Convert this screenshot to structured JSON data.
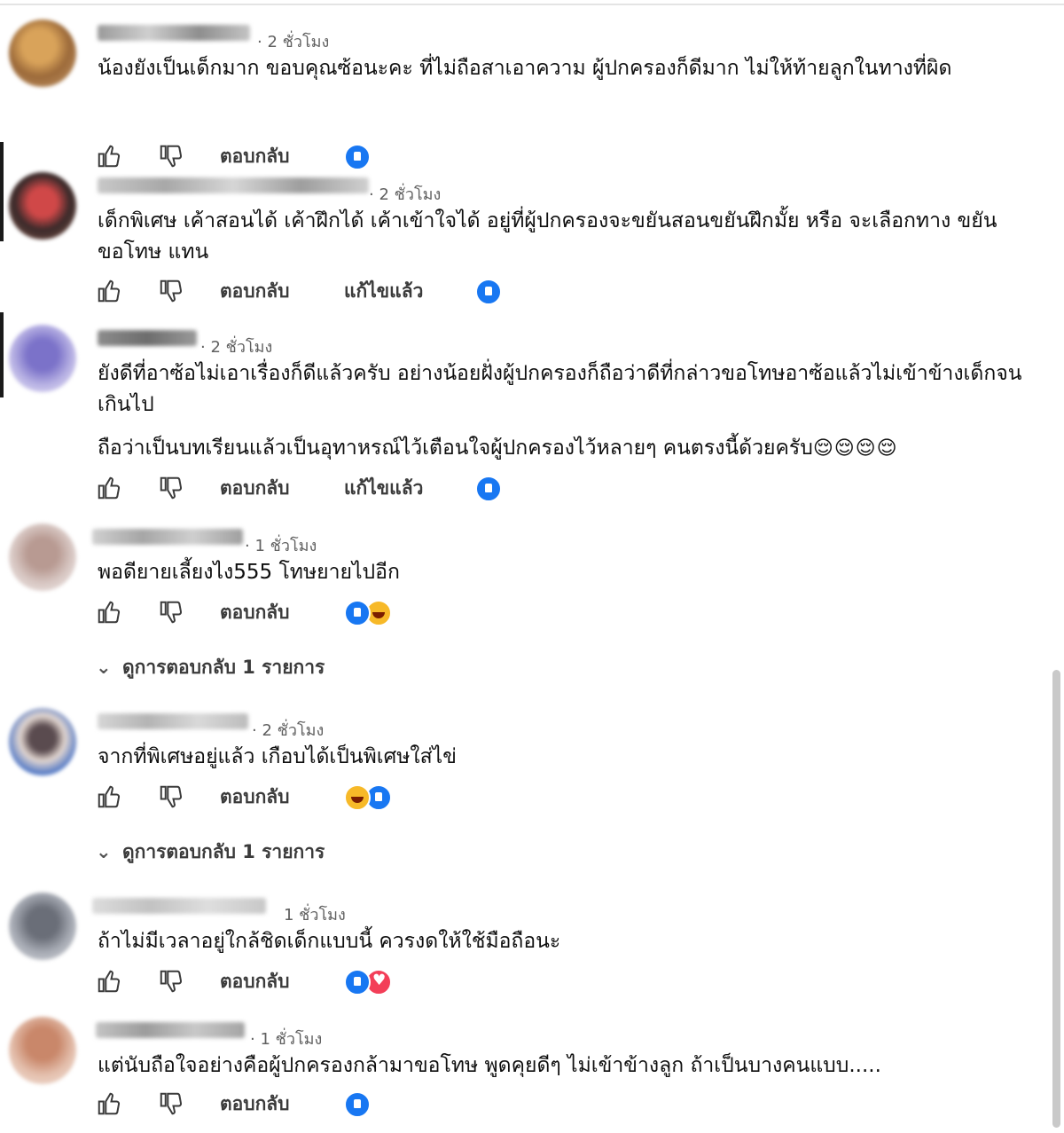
{
  "actions": {
    "reply_label": "ตอบกลับ",
    "edited_label": "แก้ไขแล้ว"
  },
  "comments": [
    {
      "time": "· 2 ชั่วโมง",
      "text": "น้องยังเป็นเด็กมาก ขอบคุณซ้อนะคะ ที่ไม่ถือสาเอาความ ผู้ปกครองก็ดีมาก ไม่ให้ท้ายลูกในทางที่ผิด",
      "edited": false,
      "reactions": [
        "like"
      ]
    },
    {
      "time": "· 2 ชั่วโมง",
      "text": "เด็กพิเศษ เค้าสอนได้ เค้าฝึกได้ เค้าเข้าใจได้ อยู่ที่ผู้ปกครองจะขยันสอนขยันฝึกมั้ย หรือ จะเลือกทาง ขยันขอโทษ แทน",
      "edited": true,
      "reactions": [
        "like"
      ]
    },
    {
      "time": "· 2 ชั่วโมง",
      "text": "ยังดีที่อาซ้อไม่เอาเรื่องก็ดีแล้วครับ อย่างน้อยฝั่งผู้ปกครองก็ถือว่าดีที่กล่าวขอโทษอาซ้อแล้วไม่เข้าข้างเด็กจนเกินไป",
      "text2": "ถือว่าเป็นบทเรียนแล้วเป็นอุทาหรณ์ไว้เตือนใจผู้ปกครองไว้หลายๆ คนตรงนี้ด้วยครับ",
      "text2_emoji": "😌😌😌😌",
      "edited": true,
      "reactions": [
        "like"
      ]
    },
    {
      "time": "· 1 ชั่วโมง",
      "text": "พอดียายเลี้ยงไง555 โทษยายไปอีก",
      "edited": false,
      "reactions": [
        "like",
        "haha"
      ],
      "view_replies": "ดูการตอบกลับ 1 รายการ"
    },
    {
      "time": "· 2 ชั่วโมง",
      "text": "จากที่พิเศษอยู่แล้ว เกือบได้เป็นพิเศษใส่ไข่",
      "edited": false,
      "reactions": [
        "haha",
        "like"
      ],
      "view_replies": "ดูการตอบกลับ 1 รายการ"
    },
    {
      "time": "1 ชั่วโมง",
      "text": "ถ้าไม่มีเวลาอยู่ใกล้ชิดเด็กแบบนี้ ควรงดให้ใช้มือถือนะ",
      "edited": false,
      "reactions": [
        "like",
        "love"
      ]
    },
    {
      "time": "· 1 ชั่วโมง",
      "text": "แต่นับถือใจอย่างคือผู้ปกครองกล้ามาขอโทษ พูดคุยดีๆ ไม่เข้าข้างลูก ถ้าเป็นบางคนแบบ.....",
      "edited": false,
      "reactions": [
        "like"
      ]
    }
  ]
}
